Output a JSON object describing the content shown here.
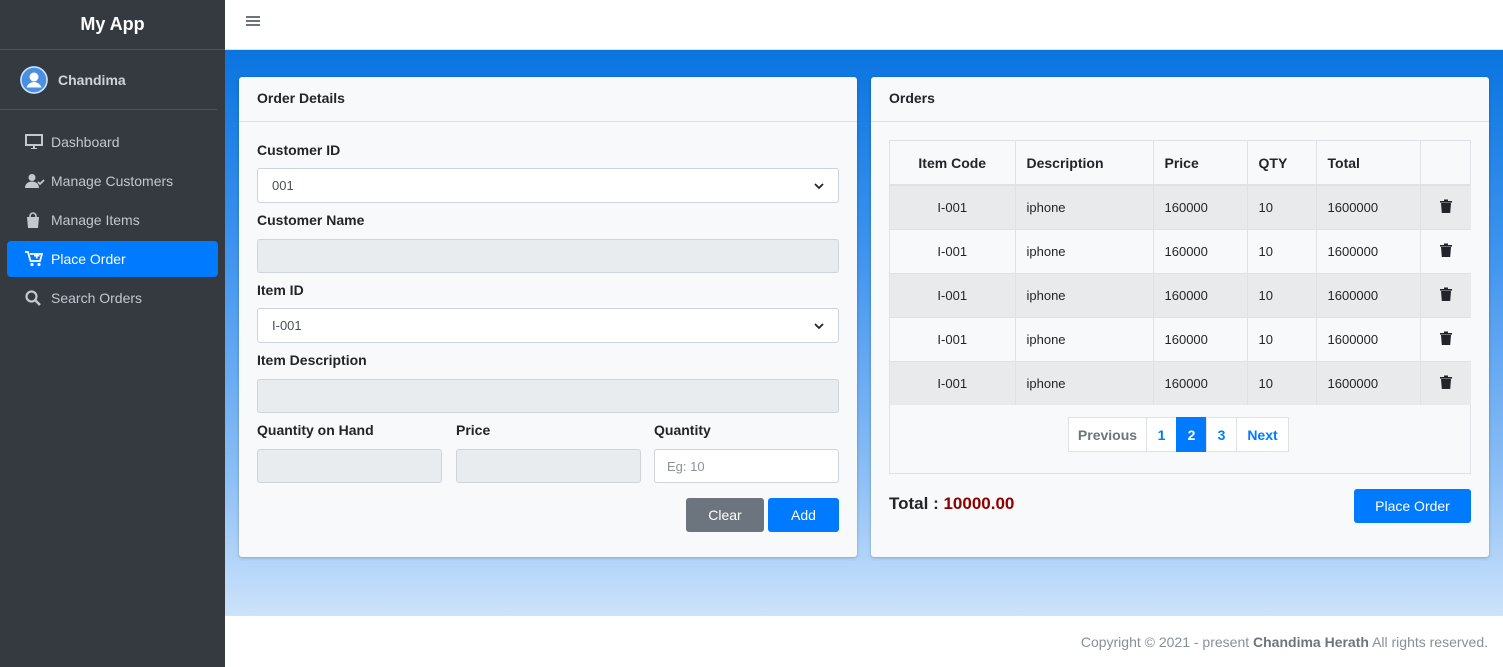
{
  "app": {
    "title": "My App"
  },
  "user": {
    "name": "Chandima"
  },
  "sidebar": {
    "items": [
      {
        "label": "Dashboard",
        "icon": "desktop-icon",
        "active": false
      },
      {
        "label": "Manage Customers",
        "icon": "users-icon",
        "active": false
      },
      {
        "label": "Manage Items",
        "icon": "shopping-bag-icon",
        "active": false
      },
      {
        "label": "Place Order",
        "icon": "cart-icon",
        "active": true
      },
      {
        "label": "Search Orders",
        "icon": "search-icon",
        "active": false
      }
    ]
  },
  "order_details": {
    "title": "Order Details",
    "customer_id_label": "Customer ID",
    "customer_id_value": "001",
    "customer_name_label": "Customer Name",
    "item_id_label": "Item ID",
    "item_id_value": "I-001",
    "item_description_label": "Item Description",
    "qty_on_hand_label": "Quantity on Hand",
    "price_label": "Price",
    "quantity_label": "Quantity",
    "quantity_placeholder": "Eg: 10",
    "clear_label": "Clear",
    "add_label": "Add"
  },
  "orders": {
    "title": "Orders",
    "columns": [
      "Item Code",
      "Description",
      "Price",
      "QTY",
      "Total",
      ""
    ],
    "rows": [
      {
        "code": "I-001",
        "description": "iphone",
        "price": "160000",
        "qty": "10",
        "total": "1600000"
      },
      {
        "code": "I-001",
        "description": "iphone",
        "price": "160000",
        "qty": "10",
        "total": "1600000"
      },
      {
        "code": "I-001",
        "description": "iphone",
        "price": "160000",
        "qty": "10",
        "total": "1600000"
      },
      {
        "code": "I-001",
        "description": "iphone",
        "price": "160000",
        "qty": "10",
        "total": "1600000"
      },
      {
        "code": "I-001",
        "description": "iphone",
        "price": "160000",
        "qty": "10",
        "total": "1600000"
      }
    ],
    "pagination": {
      "previous": "Previous",
      "pages": [
        "1",
        "2",
        "3"
      ],
      "active_page": "2",
      "next": "Next"
    },
    "total_label": "Total :",
    "total_value": "10000.00",
    "place_order_label": "Place Order"
  },
  "footer": {
    "prefix": "Copyright © 2021 - present",
    "author": "Chandima Herath",
    "suffix": "All rights reserved."
  },
  "colors": {
    "primary": "#007bff",
    "sidebar": "#343a40",
    "total_value": "#8b0000"
  }
}
